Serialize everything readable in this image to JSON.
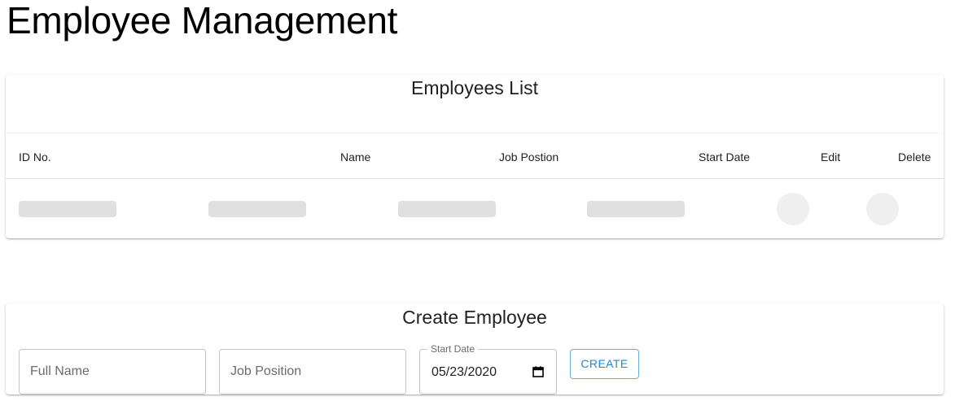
{
  "page": {
    "title": "Employee Management"
  },
  "employees_list": {
    "title": "Employees List",
    "columns": [
      "ID No.",
      "Name",
      "Job Postion",
      "Start Date",
      "Edit",
      "Delete"
    ],
    "rows_loading": true
  },
  "create_employee": {
    "title": "Create Employee",
    "full_name_placeholder": "Full Name",
    "job_position_placeholder": "Job Position",
    "start_date_label": "Start Date",
    "start_date_value": "05/23/2020",
    "create_label": "CREATE"
  },
  "colors": {
    "accent": "#1a8bd0",
    "skeleton": "#e0e0e0",
    "border": "#c4c4c4"
  },
  "icons": {
    "date_picker": "calendar-icon"
  }
}
